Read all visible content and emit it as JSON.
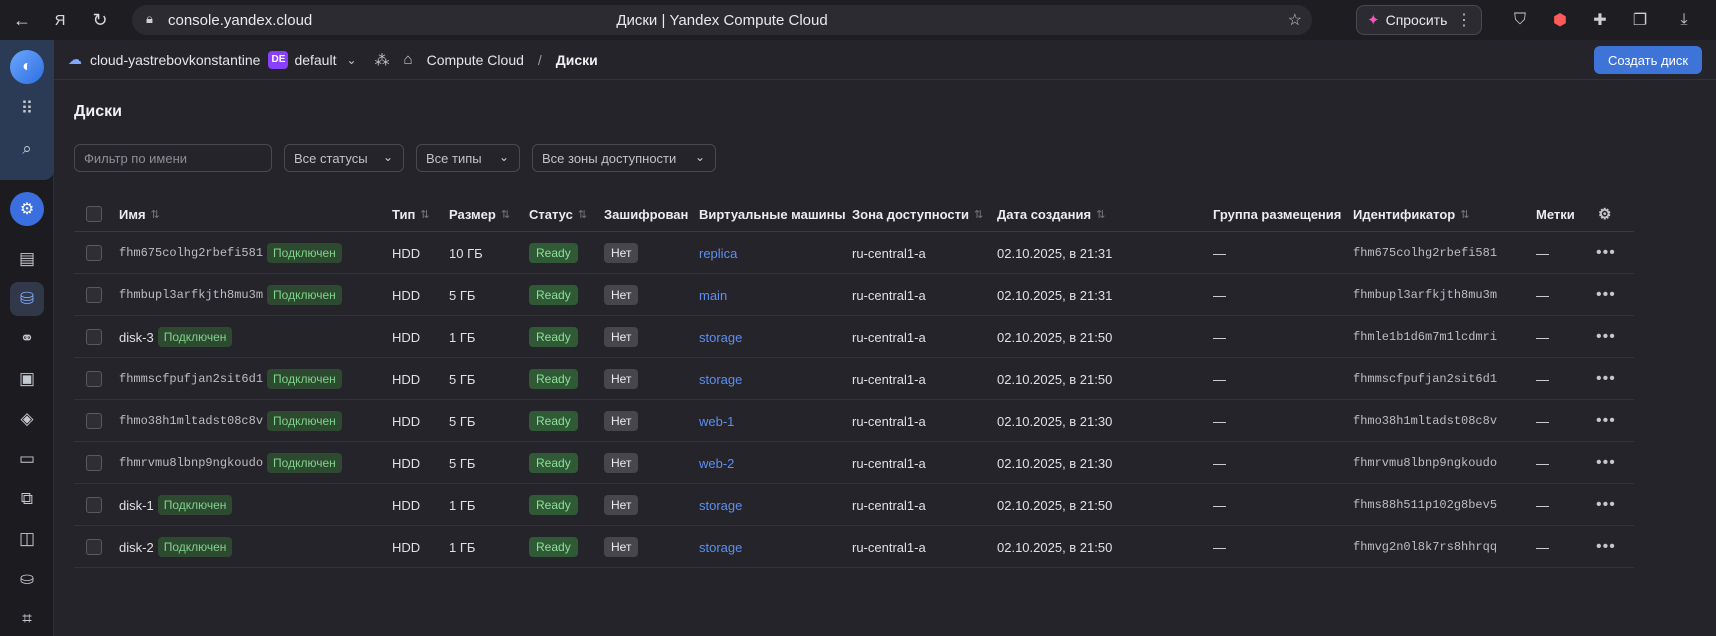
{
  "browser": {
    "url": "console.yandex.cloud",
    "tab_title": "Диски | Yandex Compute Cloud",
    "ask_button": "Спросить"
  },
  "header": {
    "cloud_name": "cloud-yastrebovkonstantine",
    "folder_badge": "DE",
    "folder_name": "default",
    "breadcrumb_service": "Compute Cloud",
    "breadcrumb_separator": "/",
    "breadcrumb_current": "Диски",
    "create_button": "Создать диск"
  },
  "page": {
    "title": "Диски"
  },
  "filters": {
    "name_placeholder": "Фильтр по имени",
    "status": "Все статусы",
    "type": "Все типы",
    "zone": "Все зоны доступности"
  },
  "table": {
    "columns": {
      "name": "Имя",
      "type": "Тип",
      "size": "Размер",
      "status": "Статус",
      "encrypted": "Зашифрован",
      "vms": "Виртуальные машины",
      "zone": "Зона доступности",
      "created": "Дата создания",
      "placement": "Группа размещения",
      "id": "Идентификатор",
      "labels": "Метки"
    },
    "rows": [
      {
        "name": "fhm675colhg2rbefi581",
        "mono": true,
        "attached": "Подключен",
        "type": "HDD",
        "size": "10 ГБ",
        "status": "Ready",
        "encrypted": "Нет",
        "vm": "replica",
        "zone": "ru-central1-a",
        "created": "02.10.2025, в 21:31",
        "placement": "—",
        "id": "fhm675colhg2rbefi581",
        "labels": "—"
      },
      {
        "name": "fhmbupl3arfkjth8mu3m",
        "mono": true,
        "attached": "Подключен",
        "type": "HDD",
        "size": "5 ГБ",
        "status": "Ready",
        "encrypted": "Нет",
        "vm": "main",
        "zone": "ru-central1-a",
        "created": "02.10.2025, в 21:31",
        "placement": "—",
        "id": "fhmbupl3arfkjth8mu3m",
        "labels": "—"
      },
      {
        "name": "disk-3",
        "mono": false,
        "attached": "Подключен",
        "type": "HDD",
        "size": "1 ГБ",
        "status": "Ready",
        "encrypted": "Нет",
        "vm": "storage",
        "zone": "ru-central1-a",
        "created": "02.10.2025, в 21:50",
        "placement": "—",
        "id": "fhmle1b1d6m7m1lcdmri",
        "labels": "—"
      },
      {
        "name": "fhmmscfpufjan2sit6d1",
        "mono": true,
        "attached": "Подключен",
        "type": "HDD",
        "size": "5 ГБ",
        "status": "Ready",
        "encrypted": "Нет",
        "vm": "storage",
        "zone": "ru-central1-a",
        "created": "02.10.2025, в 21:50",
        "placement": "—",
        "id": "fhmmscfpufjan2sit6d1",
        "labels": "—"
      },
      {
        "name": "fhmo38h1mltadst08c8v",
        "mono": true,
        "attached": "Подключен",
        "type": "HDD",
        "size": "5 ГБ",
        "status": "Ready",
        "encrypted": "Нет",
        "vm": "web-1",
        "zone": "ru-central1-a",
        "created": "02.10.2025, в 21:30",
        "placement": "—",
        "id": "fhmo38h1mltadst08c8v",
        "labels": "—"
      },
      {
        "name": "fhmrvmu8lbnp9ngkoudo",
        "mono": true,
        "attached": "Подключен",
        "type": "HDD",
        "size": "5 ГБ",
        "status": "Ready",
        "encrypted": "Нет",
        "vm": "web-2",
        "zone": "ru-central1-a",
        "created": "02.10.2025, в 21:30",
        "placement": "—",
        "id": "fhmrvmu8lbnp9ngkoudo",
        "labels": "—"
      },
      {
        "name": "disk-1",
        "mono": false,
        "attached": "Подключен",
        "type": "HDD",
        "size": "1 ГБ",
        "status": "Ready",
        "encrypted": "Нет",
        "vm": "storage",
        "zone": "ru-central1-a",
        "created": "02.10.2025, в 21:50",
        "placement": "—",
        "id": "fhms88h511p102g8bev5",
        "labels": "—"
      },
      {
        "name": "disk-2",
        "mono": false,
        "attached": "Подключен",
        "type": "HDD",
        "size": "1 ГБ",
        "status": "Ready",
        "encrypted": "Нет",
        "vm": "storage",
        "zone": "ru-central1-a",
        "created": "02.10.2025, в 21:50",
        "placement": "—",
        "id": "fhmvg2n0l8k7rs8hhrqq",
        "labels": "—"
      }
    ]
  }
}
